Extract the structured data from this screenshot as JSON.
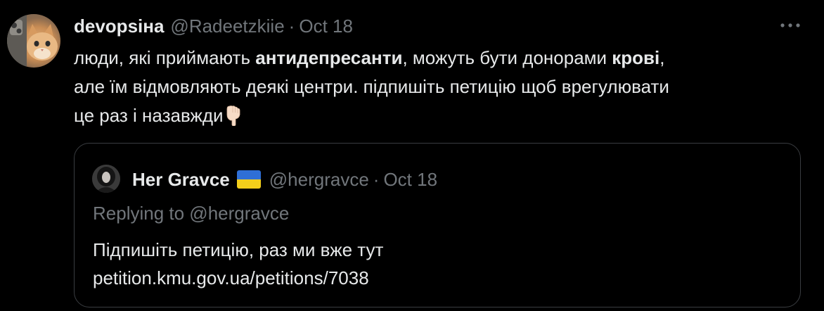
{
  "tweet": {
    "author_name": "devopsіна",
    "handle": "@Radeetzkiie",
    "separator": "·",
    "date": "Oct 18",
    "more_icon": "more-dots-icon",
    "text": {
      "line1_a": "люди, які приймають ",
      "line1_b": "антидепресанти",
      "line1_c": ", можуть бути донорами ",
      "line1_d": "крові",
      "line1_e": ",",
      "line2": "але їм відмовляють деякі центри. підпишіть петицію щоб врегулювати",
      "line3": "це раз і назавжди",
      "emoji": "pointing-down-hand-emoji"
    }
  },
  "quote": {
    "author_name": "Her Gravce",
    "flag": "ukraine-flag-icon",
    "flag_colors": [
      "#2f6fd6",
      "#f3cf1b"
    ],
    "handle": "@hergravce",
    "separator": "·",
    "date": "Oct 18",
    "replying": "Replying to @hergravce",
    "line1": "Підпишіть петицію, раз ми вже тут",
    "line2": "petition.kmu.gov.ua/petitions/7038"
  },
  "colors": {
    "background": "#000000",
    "text": "#e7e9ea",
    "muted": "#71767b",
    "border": "#3a3d41"
  }
}
